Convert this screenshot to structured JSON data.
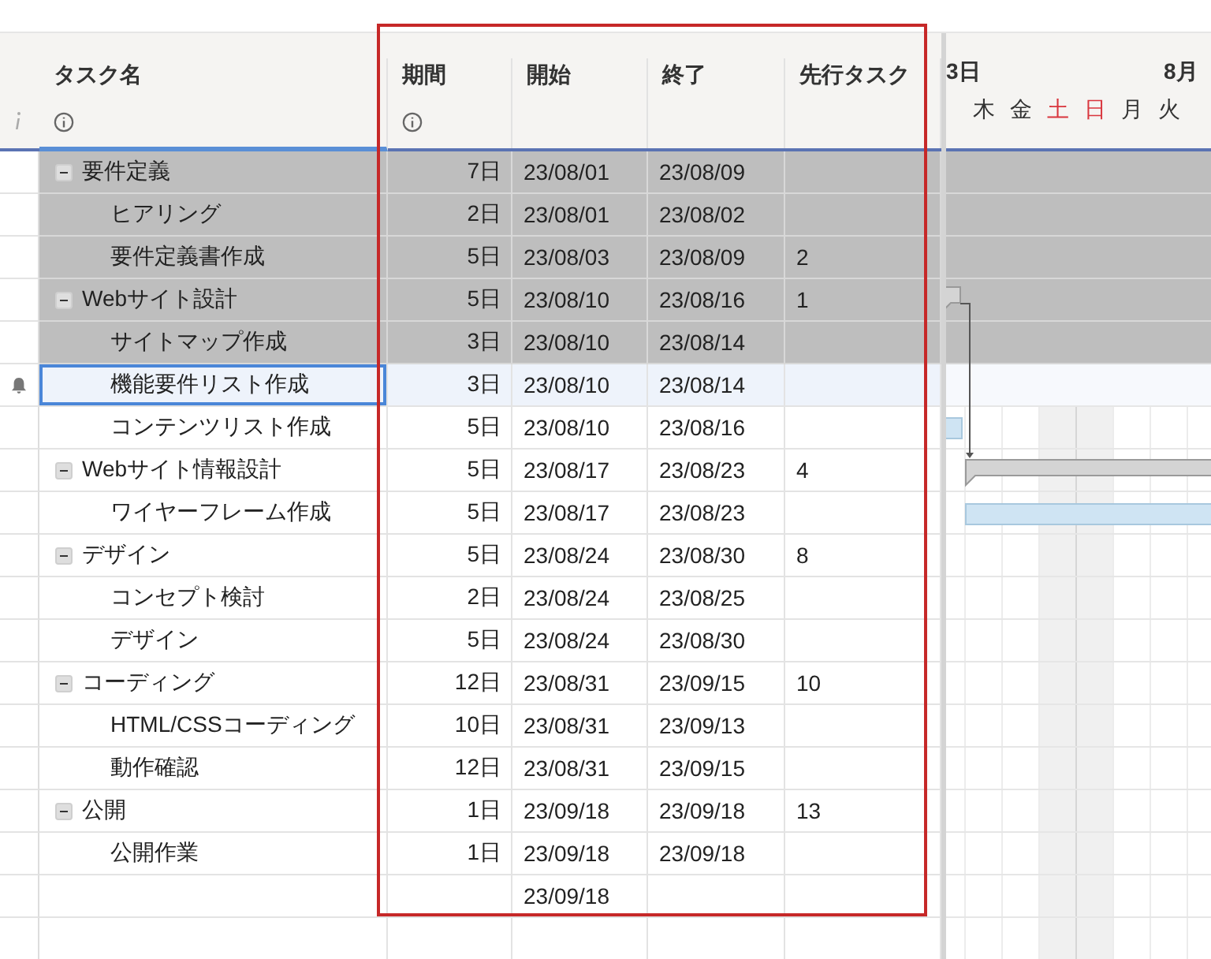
{
  "columns": [
    {
      "label": "タスク名",
      "info": true
    },
    {
      "label": "期間",
      "info": true
    },
    {
      "label": "開始",
      "info": false
    },
    {
      "label": "終了",
      "info": false
    },
    {
      "label": "先行タスク",
      "info": false
    }
  ],
  "tasks": [
    {
      "name": "要件定義",
      "duration": "7日",
      "start": "23/08/01",
      "end": "23/08/09",
      "expanded": true,
      "highlighted": true,
      "selected": false,
      "children": [
        {
          "name": "ヒアリング",
          "duration": "2日",
          "start": "23/08/01",
          "end": "23/08/02",
          "highlighted": true,
          "selected": false
        },
        {
          "name": "要件定義書作成",
          "duration": "5日",
          "start": "23/08/03",
          "end": "23/08/09",
          "predecessor": "2",
          "highlighted": true,
          "selected": false
        }
      ]
    },
    {
      "name": "Webサイト設計",
      "duration": "5日",
      "start": "23/08/10",
      "end": "23/08/16",
      "predecessor": "1",
      "expanded": true,
      "highlighted": true,
      "selected": false,
      "children": [
        {
          "name": "サイトマップ作成",
          "duration": "3日",
          "start": "23/08/10",
          "end": "23/08/14",
          "highlighted": true,
          "selected": false
        },
        {
          "name": "機能要件リスト作成",
          "duration": "3日",
          "start": "23/08/10",
          "end": "23/08/14",
          "highlighted": false,
          "selected": true
        },
        {
          "name": "コンテンツリスト作成",
          "duration": "5日",
          "start": "23/08/10",
          "end": "23/08/16",
          "highlighted": false,
          "selected": false
        }
      ]
    },
    {
      "name": "Webサイト情報設計",
      "duration": "5日",
      "start": "23/08/17",
      "end": "23/08/23",
      "predecessor": "4",
      "expanded": true,
      "highlighted": false,
      "selected": false,
      "children": [
        {
          "name": "ワイヤーフレーム作成",
          "duration": "5日",
          "start": "23/08/17",
          "end": "23/08/23",
          "highlighted": false,
          "selected": false
        }
      ]
    },
    {
      "name": "デザイン",
      "duration": "5日",
      "start": "23/08/24",
      "end": "23/08/30",
      "predecessor": "8",
      "expanded": true,
      "highlighted": false,
      "selected": false,
      "children": [
        {
          "name": "コンセプト検討",
          "duration": "2日",
          "start": "23/08/24",
          "end": "23/08/25",
          "highlighted": false,
          "selected": false
        },
        {
          "name": "デザイン",
          "duration": "5日",
          "start": "23/08/24",
          "end": "23/08/30",
          "highlighted": false,
          "selected": false
        }
      ]
    },
    {
      "name": "コーディング",
      "duration": "12日",
      "start": "23/08/31",
      "end": "23/09/15",
      "predecessor": "10",
      "expanded": true,
      "highlighted": false,
      "selected": false,
      "children": [
        {
          "name": "HTML/CSSコーディング",
          "duration": "10日",
          "start": "23/08/31",
          "end": "23/09/13",
          "highlighted": false,
          "selected": false
        },
        {
          "name": "動作確認",
          "duration": "12日",
          "start": "23/08/31",
          "end": "23/09/15",
          "highlighted": false,
          "selected": false
        }
      ]
    },
    {
      "name": "公開",
      "duration": "1日",
      "start": "23/09/18",
      "end": "23/09/18",
      "predecessor": "13",
      "expanded": true,
      "highlighted": false,
      "selected": false,
      "children": [
        {
          "name": "公開作業",
          "duration": "1日",
          "start": "23/09/18",
          "end": "23/09/18",
          "highlighted": false,
          "selected": false
        }
      ]
    }
  ],
  "summary_row": {
    "start": "23/09/18"
  },
  "gantt": {
    "week_start": "3日",
    "next_week": "8月",
    "days": [
      {
        "label": "木",
        "weekend": false
      },
      {
        "label": "金",
        "weekend": false
      },
      {
        "label": "土",
        "weekend": true
      },
      {
        "label": "日",
        "weekend": true
      },
      {
        "label": "月",
        "weekend": false
      },
      {
        "label": "火",
        "weekend": false
      }
    ]
  }
}
